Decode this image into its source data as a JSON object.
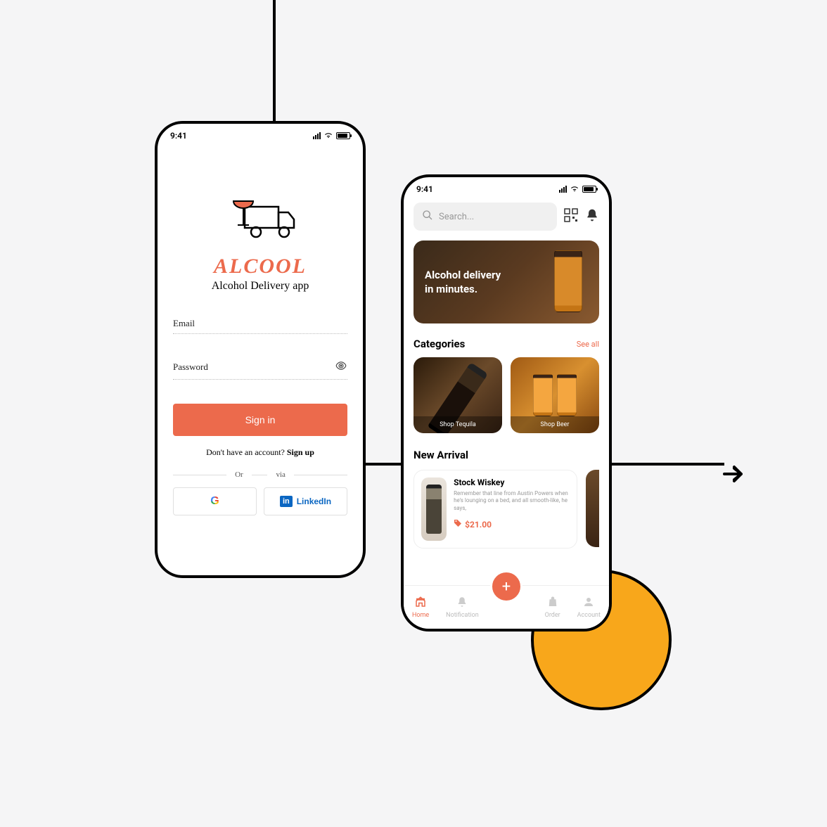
{
  "status": {
    "time": "9:41"
  },
  "phone1": {
    "brand": "ALCOOL",
    "subtitle": "Alcohol Delivery app",
    "email_label": "Email",
    "password_label": "Password",
    "signin": "Sign in",
    "signup_prompt": "Don't have an account? ",
    "signup_link": "Sign up",
    "or": "Or",
    "via": "via",
    "linkedin": "LinkedIn"
  },
  "phone2": {
    "search_placeholder": "Search...",
    "hero_line1": "Alcohol delivery",
    "hero_line2": "in minutes.",
    "categories_title": "Categories",
    "see_all": "See all",
    "cat1": "Shop Tequila",
    "cat2": "Shop Beer",
    "arrival_title": "New Arrival",
    "product": {
      "name": "Stock Wiskey",
      "desc": "Remember that line from Austin Powers when he's lounging on a bed, and all smooth-like, he says,",
      "price": "$21.00"
    },
    "nav": {
      "home": "Home",
      "notification": "Notification",
      "order": "Order",
      "account": "Account"
    }
  }
}
